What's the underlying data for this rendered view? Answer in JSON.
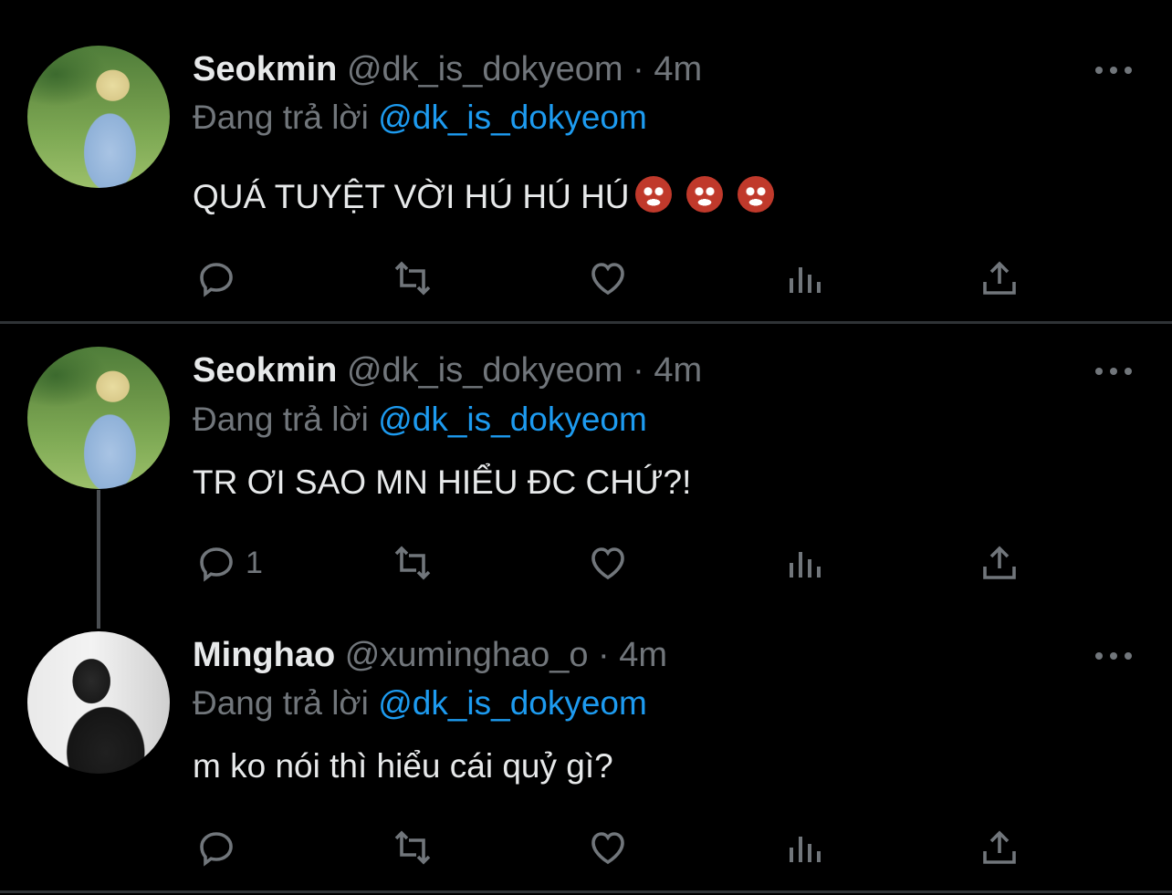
{
  "tweets": [
    {
      "name": "Seokmin",
      "meta": " @dk_is_dokyeom · 4m",
      "reply_prefix": "Đang trả lời ",
      "reply_handle": "@dk_is_dokyeom",
      "text": "QUÁ TUYỆT VỜI HÚ HÚ HÚ",
      "emoji": [
        "ogre-emoji",
        "ogre-emoji",
        "ogre-emoji"
      ],
      "reply_count": ""
    },
    {
      "name": "Seokmin",
      "meta": " @dk_is_dokyeom · 4m",
      "reply_prefix": "Đang trả lời ",
      "reply_handle": "@dk_is_dokyeom",
      "text": "TR ƠI SAO MN HIỂU ĐC CHỨ?!",
      "reply_count": "1"
    },
    {
      "name": "Minghao",
      "meta": " @xuminghao_o · 4m",
      "reply_prefix": "Đang trả lời ",
      "reply_handle": "@dk_is_dokyeom",
      "text": "m ko nói thì hiểu cái quỷ gì?",
      "reply_count": ""
    }
  ],
  "icons": [
    "reply-icon",
    "retweet-icon",
    "like-icon",
    "analytics-icon",
    "share-icon",
    "more-icon"
  ],
  "colors": {
    "background": "#000000",
    "text": "#e7e9ea",
    "muted": "#71767b",
    "link": "#1d9bf0",
    "divider": "#2f3336"
  }
}
